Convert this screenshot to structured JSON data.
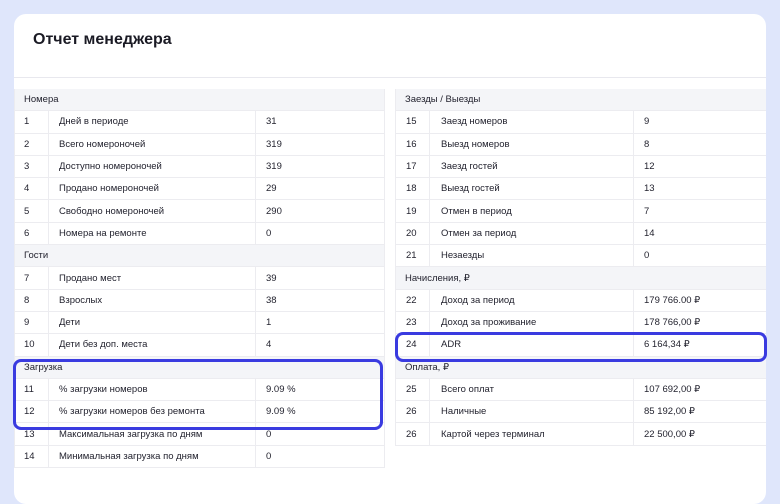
{
  "title": "Отчет менеджера",
  "left": [
    {
      "section": "Номера"
    },
    {
      "n": "1",
      "name": "Дней в периоде",
      "value": "31"
    },
    {
      "n": "2",
      "name": "Всего номероночей",
      "value": "319"
    },
    {
      "n": "3",
      "name": "Доступно номероночей",
      "value": "319"
    },
    {
      "n": "4",
      "name": "Продано номероночей",
      "value": "29"
    },
    {
      "n": "5",
      "name": "Свободно номероночей",
      "value": "290"
    },
    {
      "n": "6",
      "name": "Номера на ремонте",
      "value": "0"
    },
    {
      "section": "Гости"
    },
    {
      "n": "7",
      "name": "Продано мест",
      "value": "39"
    },
    {
      "n": "8",
      "name": "Взрослых",
      "value": "38"
    },
    {
      "n": "9",
      "name": "Дети",
      "value": "1"
    },
    {
      "n": "10",
      "name": "Дети без доп. места",
      "value": "4"
    },
    {
      "section": "Загрузка"
    },
    {
      "n": "11",
      "name": "% загрузки номеров",
      "value": "9.09 %"
    },
    {
      "n": "12",
      "name": "% загрузки номеров без ремонта",
      "value": "9.09 %"
    },
    {
      "n": "13",
      "name": "Максимальная загрузка по дням",
      "value": "0"
    },
    {
      "n": "14",
      "name": "Минимальная загрузка по дням",
      "value": "0"
    }
  ],
  "right": [
    {
      "section": "Заезды / Выезды"
    },
    {
      "n": "15",
      "name": "Заезд номеров",
      "value": "9"
    },
    {
      "n": "16",
      "name": "Выезд номеров",
      "value": "8"
    },
    {
      "n": "17",
      "name": "Заезд гостей",
      "value": "12"
    },
    {
      "n": "18",
      "name": "Выезд гостей",
      "value": "13"
    },
    {
      "n": "19",
      "name": "Отмен в период",
      "value": "7"
    },
    {
      "n": "20",
      "name": "Отмен за период",
      "value": "14"
    },
    {
      "n": "21",
      "name": "Незаезды",
      "value": "0"
    },
    {
      "section": "Начисления, ₽"
    },
    {
      "n": "22",
      "name": "Доход за период",
      "value": "179 766.00 ₽"
    },
    {
      "n": "23",
      "name": "Доход за проживание",
      "value": "178 766,00 ₽"
    },
    {
      "n": "24",
      "name": "ADR",
      "value": "6 164,34 ₽"
    },
    {
      "section": "Оплата, ₽"
    },
    {
      "n": "25",
      "name": "Всего оплат",
      "value": "107 692,00 ₽"
    },
    {
      "n": "26",
      "name": "Наличные",
      "value": "85 192,00 ₽"
    },
    {
      "n": "26",
      "name": "Картой через терминал",
      "value": "22 500,00 ₽"
    }
  ],
  "accent": "#3a3be0"
}
